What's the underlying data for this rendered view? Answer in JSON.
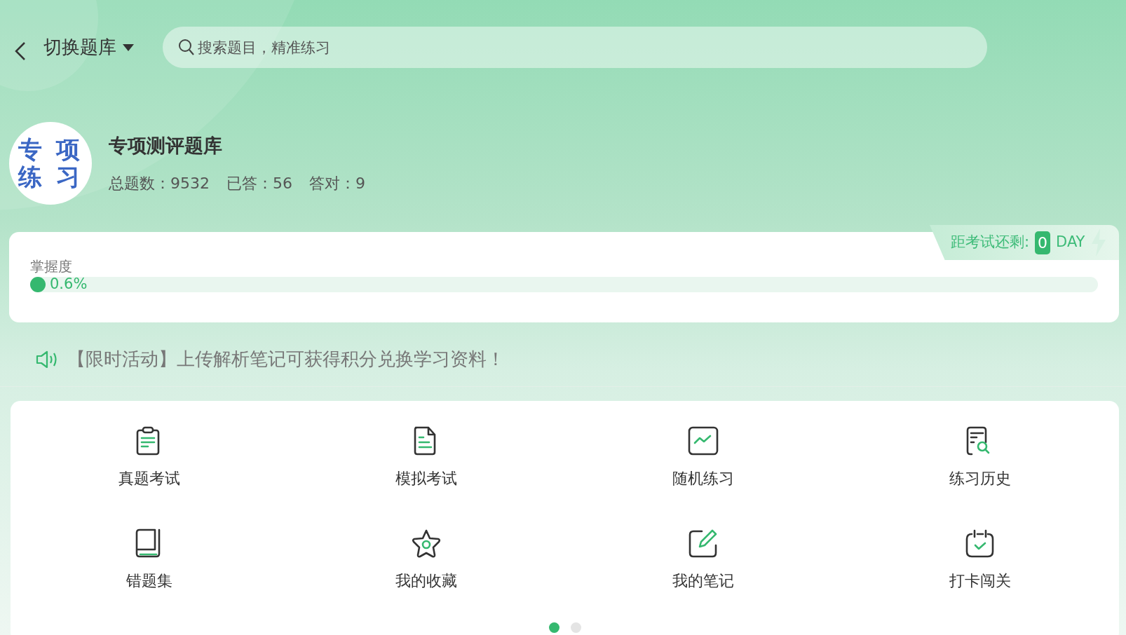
{
  "header": {
    "switch_label": "切换题库",
    "search": {
      "placeholder": "搜索题目，精准练习"
    }
  },
  "bank": {
    "logo_lines": [
      "专 项",
      "练 习"
    ],
    "title": "专项测评题库",
    "stats": [
      {
        "label": "总题数：",
        "value": "9532"
      },
      {
        "label": "已答：",
        "value": "56"
      },
      {
        "label": "答对：",
        "value": "9"
      }
    ]
  },
  "countdown": {
    "label": "距考试还剩:",
    "days": "0",
    "unit": "DAY"
  },
  "mastery": {
    "label": "掌握度",
    "level": 0.006,
    "reading": "0.6%"
  },
  "notice": "【限时活动】上传解析笔记可获得积分兑换学习资料！",
  "features": [
    {
      "kind": "clipboard",
      "label": "真题考试"
    },
    {
      "kind": "document",
      "label": "模拟考试"
    },
    {
      "kind": "chart",
      "label": "随机练习"
    },
    {
      "kind": "history",
      "label": "练习历史"
    },
    {
      "kind": "book",
      "label": "错题集"
    },
    {
      "kind": "star",
      "label": "我的收藏"
    },
    {
      "kind": "note",
      "label": "我的笔记"
    },
    {
      "kind": "calendar",
      "label": "打卡闯关"
    }
  ],
  "pages": [
    {
      "selected": true
    },
    {
      "selected": false
    }
  ]
}
